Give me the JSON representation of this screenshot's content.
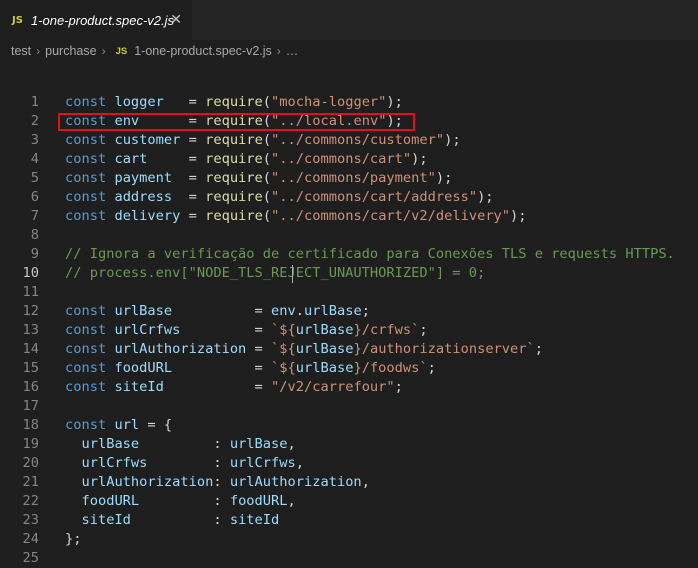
{
  "tab": {
    "badge": "JS",
    "title": "1-one-product.spec-v2.js",
    "close": "✕"
  },
  "breadcrumb": {
    "items": [
      "test",
      "purchase"
    ],
    "file_badge": "JS",
    "file": "1-one-product.spec-v2.js",
    "tail": "…"
  },
  "editor": {
    "active_line": 10,
    "highlighted_line": 2,
    "lines": [
      {
        "n": "1",
        "tokens": [
          [
            "kw",
            "const"
          ],
          [
            "op",
            " "
          ],
          [
            "id",
            "logger"
          ],
          [
            "op",
            "   = "
          ],
          [
            "fn",
            "require"
          ],
          [
            "op",
            "("
          ],
          [
            "str",
            "\"mocha-logger\""
          ],
          [
            "op",
            ");"
          ]
        ]
      },
      {
        "n": "2",
        "tokens": [
          [
            "kw",
            "const"
          ],
          [
            "op",
            " "
          ],
          [
            "id",
            "env"
          ],
          [
            "op",
            "      = "
          ],
          [
            "fn",
            "require"
          ],
          [
            "op",
            "("
          ],
          [
            "str",
            "\"../local.env\""
          ],
          [
            "op",
            ");"
          ]
        ]
      },
      {
        "n": "3",
        "tokens": [
          [
            "kw",
            "const"
          ],
          [
            "op",
            " "
          ],
          [
            "id",
            "customer"
          ],
          [
            "op",
            " = "
          ],
          [
            "fn",
            "require"
          ],
          [
            "op",
            "("
          ],
          [
            "str",
            "\"../commons/customer\""
          ],
          [
            "op",
            ");"
          ]
        ]
      },
      {
        "n": "4",
        "tokens": [
          [
            "kw",
            "const"
          ],
          [
            "op",
            " "
          ],
          [
            "id",
            "cart"
          ],
          [
            "op",
            "     = "
          ],
          [
            "fn",
            "require"
          ],
          [
            "op",
            "("
          ],
          [
            "str",
            "\"../commons/cart\""
          ],
          [
            "op",
            ");"
          ]
        ]
      },
      {
        "n": "5",
        "tokens": [
          [
            "kw",
            "const"
          ],
          [
            "op",
            " "
          ],
          [
            "id",
            "payment"
          ],
          [
            "op",
            "  = "
          ],
          [
            "fn",
            "require"
          ],
          [
            "op",
            "("
          ],
          [
            "str",
            "\"../commons/payment\""
          ],
          [
            "op",
            ");"
          ]
        ]
      },
      {
        "n": "6",
        "tokens": [
          [
            "kw",
            "const"
          ],
          [
            "op",
            " "
          ],
          [
            "id",
            "address"
          ],
          [
            "op",
            "  = "
          ],
          [
            "fn",
            "require"
          ],
          [
            "op",
            "("
          ],
          [
            "str",
            "\"../commons/cart/address\""
          ],
          [
            "op",
            ");"
          ]
        ]
      },
      {
        "n": "7",
        "tokens": [
          [
            "kw",
            "const"
          ],
          [
            "op",
            " "
          ],
          [
            "id",
            "delivery"
          ],
          [
            "op",
            " = "
          ],
          [
            "fn",
            "require"
          ],
          [
            "op",
            "("
          ],
          [
            "str",
            "\"../commons/cart/v2/delivery\""
          ],
          [
            "op",
            ");"
          ]
        ]
      },
      {
        "n": "8",
        "tokens": []
      },
      {
        "n": "9",
        "tokens": [
          [
            "cm",
            "// Ignora a verificação de certificado para Conexões TLS e requests HTTPS."
          ]
        ]
      },
      {
        "n": "10",
        "tokens": [
          [
            "cm",
            "// process.env[\"NODE_TLS_REJECT_UNAUTHORIZED\"] = 0;"
          ]
        ]
      },
      {
        "n": "11",
        "tokens": []
      },
      {
        "n": "12",
        "tokens": [
          [
            "kw",
            "const"
          ],
          [
            "op",
            " "
          ],
          [
            "id",
            "urlBase"
          ],
          [
            "op",
            "          = "
          ],
          [
            "id",
            "env"
          ],
          [
            "op",
            "."
          ],
          [
            "id",
            "urlBase"
          ],
          [
            "op",
            ";"
          ]
        ]
      },
      {
        "n": "13",
        "tokens": [
          [
            "kw",
            "const"
          ],
          [
            "op",
            " "
          ],
          [
            "id",
            "urlCrfws"
          ],
          [
            "op",
            "         = "
          ],
          [
            "str",
            "`${"
          ],
          [
            "id",
            "urlBase"
          ],
          [
            "str",
            "}/crfws`"
          ],
          [
            "op",
            ";"
          ]
        ]
      },
      {
        "n": "14",
        "tokens": [
          [
            "kw",
            "const"
          ],
          [
            "op",
            " "
          ],
          [
            "id",
            "urlAuthorization"
          ],
          [
            "op",
            " = "
          ],
          [
            "str",
            "`${"
          ],
          [
            "id",
            "urlBase"
          ],
          [
            "str",
            "}/authorizationserver`"
          ],
          [
            "op",
            ";"
          ]
        ]
      },
      {
        "n": "15",
        "tokens": [
          [
            "kw",
            "const"
          ],
          [
            "op",
            " "
          ],
          [
            "id",
            "foodURL"
          ],
          [
            "op",
            "          = "
          ],
          [
            "str",
            "`${"
          ],
          [
            "id",
            "urlBase"
          ],
          [
            "str",
            "}/foodws`"
          ],
          [
            "op",
            ";"
          ]
        ]
      },
      {
        "n": "16",
        "tokens": [
          [
            "kw",
            "const"
          ],
          [
            "op",
            " "
          ],
          [
            "id",
            "siteId"
          ],
          [
            "op",
            "           = "
          ],
          [
            "str",
            "\"/v2/carrefour\""
          ],
          [
            "op",
            ";"
          ]
        ]
      },
      {
        "n": "17",
        "tokens": []
      },
      {
        "n": "18",
        "tokens": [
          [
            "kw",
            "const"
          ],
          [
            "op",
            " "
          ],
          [
            "id",
            "url"
          ],
          [
            "op",
            " = {"
          ]
        ]
      },
      {
        "n": "19",
        "tokens": [
          [
            "op",
            "  "
          ],
          [
            "id",
            "urlBase"
          ],
          [
            "op",
            "         : "
          ],
          [
            "id",
            "urlBase"
          ],
          [
            "op",
            ","
          ]
        ]
      },
      {
        "n": "20",
        "tokens": [
          [
            "op",
            "  "
          ],
          [
            "id",
            "urlCrfws"
          ],
          [
            "op",
            "        : "
          ],
          [
            "id",
            "urlCrfws"
          ],
          [
            "op",
            ","
          ]
        ]
      },
      {
        "n": "21",
        "tokens": [
          [
            "op",
            "  "
          ],
          [
            "id",
            "urlAuthorization"
          ],
          [
            "op",
            ": "
          ],
          [
            "id",
            "urlAuthorization"
          ],
          [
            "op",
            ","
          ]
        ]
      },
      {
        "n": "22",
        "tokens": [
          [
            "op",
            "  "
          ],
          [
            "id",
            "foodURL"
          ],
          [
            "op",
            "         : "
          ],
          [
            "id",
            "foodURL"
          ],
          [
            "op",
            ","
          ]
        ]
      },
      {
        "n": "23",
        "tokens": [
          [
            "op",
            "  "
          ],
          [
            "id",
            "siteId"
          ],
          [
            "op",
            "          : "
          ],
          [
            "id",
            "siteId"
          ]
        ]
      },
      {
        "n": "24",
        "tokens": [
          [
            "op",
            "};"
          ]
        ]
      },
      {
        "n": "25",
        "tokens": []
      }
    ]
  }
}
